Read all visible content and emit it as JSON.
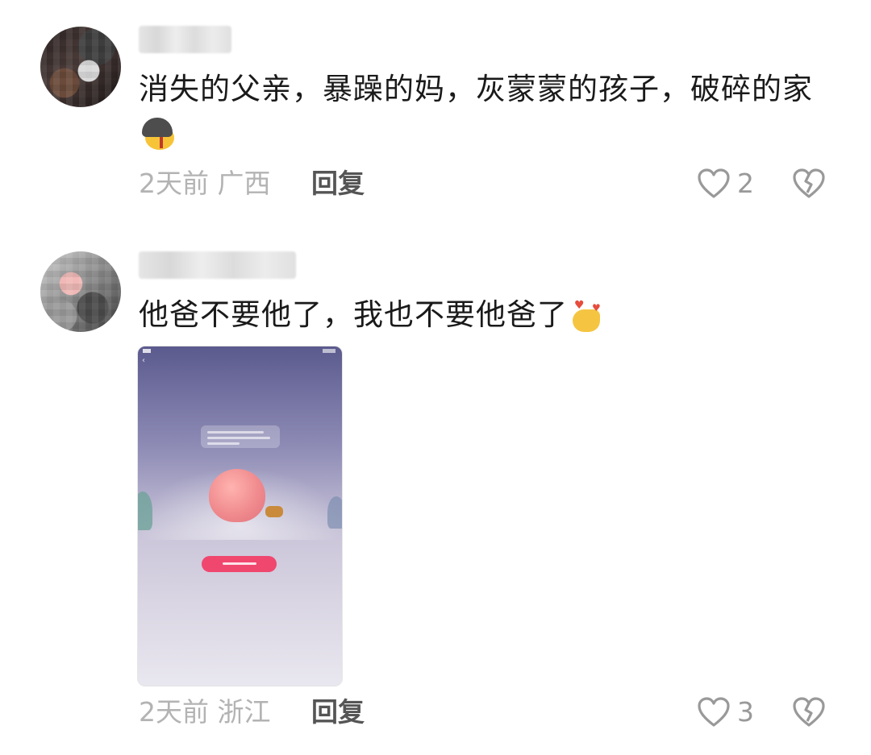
{
  "colors": {
    "text": "#1a1a1a",
    "meta": "#b3b3b3",
    "reply": "#555555",
    "like": "#999999",
    "thumb_button": "#f0476f"
  },
  "comments": [
    {
      "text": "消失的父亲，暴躁的妈，灰蒙蒙的孩子，破碎的家",
      "emoji": "helmet-emoji",
      "time_location": "2天前 广西",
      "reply_label": "回复",
      "like_count": "2",
      "like_icon": "heart-outline-icon",
      "dislike_icon": "broken-heart-icon"
    },
    {
      "text": "他爸不要他了，我也不要他爸了",
      "emoji": "heart-hand-emoji",
      "time_location": "2天前 浙江",
      "reply_label": "回复",
      "like_count": "3",
      "like_icon": "heart-outline-icon",
      "dislike_icon": "broken-heart-icon"
    }
  ]
}
